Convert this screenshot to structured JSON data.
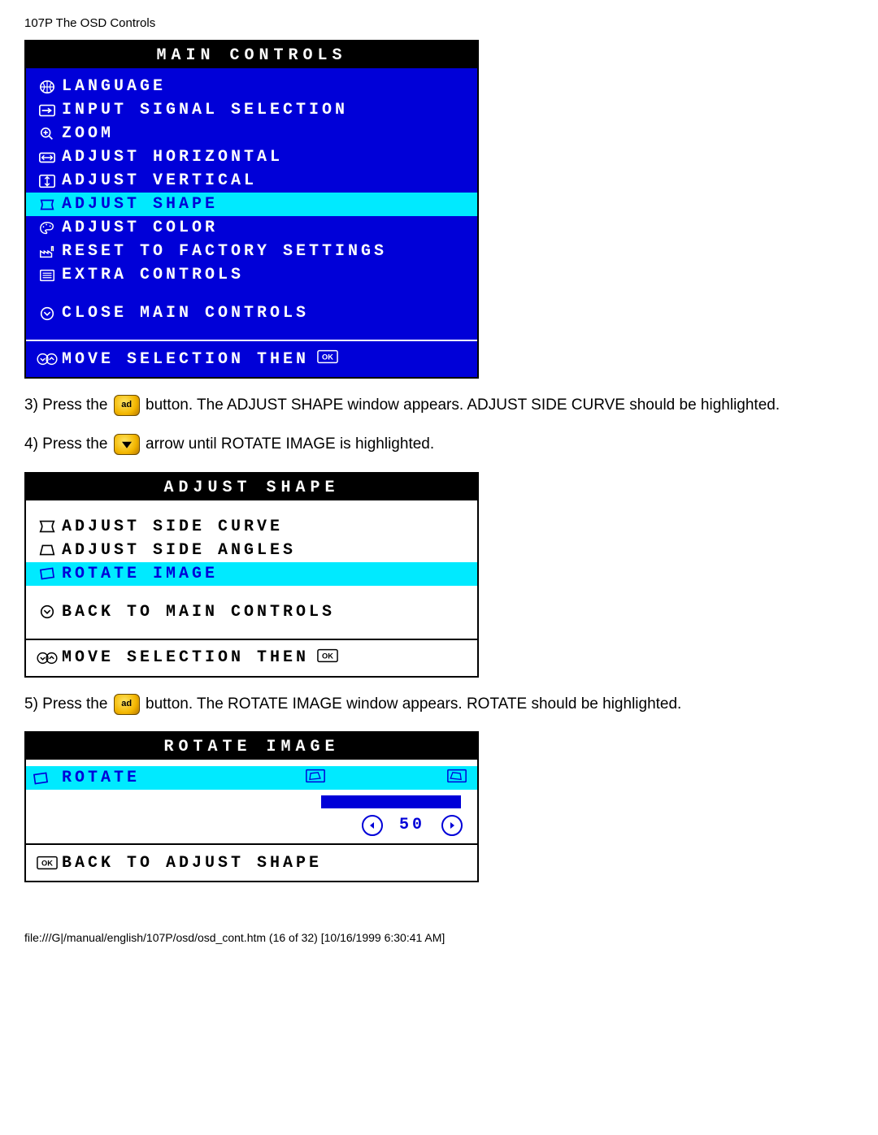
{
  "doc": {
    "header": "107P The OSD Controls",
    "footer": "file:///G|/manual/english/107P/osd/osd_cont.htm (16 of 32) [10/16/1999 6:30:41 AM]"
  },
  "osd_main": {
    "title": "MAIN CONTROLS",
    "items": [
      "LANGUAGE",
      "INPUT SIGNAL SELECTION",
      "ZOOM",
      "ADJUST HORIZONTAL",
      "ADJUST VERTICAL",
      "ADJUST SHAPE",
      "ADJUST COLOR",
      "RESET TO FACTORY SETTINGS",
      "EXTRA CONTROLS"
    ],
    "close": "CLOSE MAIN CONTROLS",
    "footer": "MOVE SELECTION THEN"
  },
  "step3": {
    "pre": "3) Press the ",
    "btn": "ad",
    "post": " button. The ADJUST SHAPE window appears. ADJUST SIDE CURVE should be highlighted."
  },
  "step4": {
    "pre": "4) Press the ",
    "post": " arrow until ROTATE IMAGE is highlighted."
  },
  "osd_shape": {
    "title": "ADJUST SHAPE",
    "items": [
      "ADJUST SIDE CURVE",
      "ADJUST SIDE ANGLES",
      "ROTATE IMAGE"
    ],
    "back": "BACK TO MAIN CONTROLS",
    "footer": "MOVE SELECTION THEN"
  },
  "step5": {
    "pre": "5) Press the ",
    "btn": "ad",
    "post": " button. The ROTATE IMAGE window appears. ROTATE should be highlighted."
  },
  "osd_rotate": {
    "title": "ROTATE IMAGE",
    "item": "ROTATE",
    "value": "50",
    "back": "BACK TO ADJUST SHAPE"
  }
}
